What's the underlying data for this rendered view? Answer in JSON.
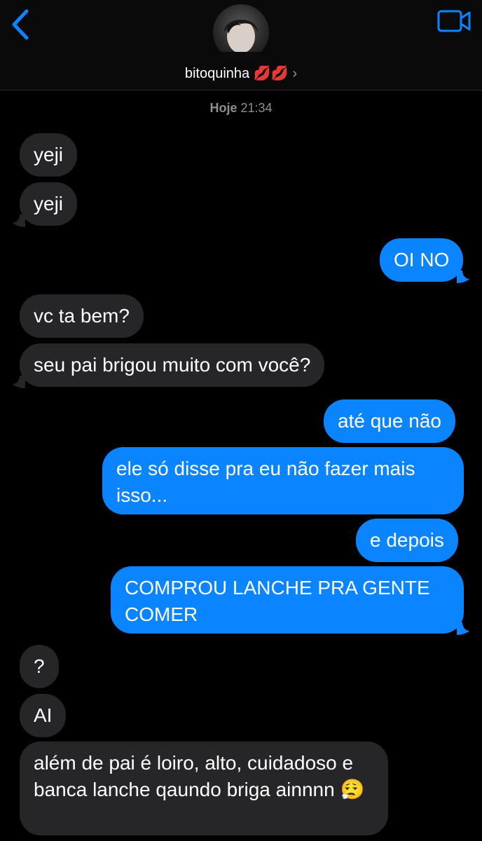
{
  "header": {
    "contact_name": "bitoquinha 💋💋",
    "chevron": "›",
    "icons": {
      "back": "chevron-left-icon",
      "video": "video-camera-icon"
    },
    "accent_color": "#0a84ff"
  },
  "timestamp": {
    "day": "Hoje",
    "time": "21:34"
  },
  "messages": [
    {
      "side": "in",
      "text": "yeji"
    },
    {
      "side": "in",
      "text": "yeji"
    },
    {
      "side": "out",
      "text": "OI NO"
    },
    {
      "side": "in",
      "text": "vc ta bem?"
    },
    {
      "side": "in",
      "text": "seu pai brigou muito com você?"
    },
    {
      "side": "out",
      "text": "até que não"
    },
    {
      "side": "out",
      "text": "ele só disse pra eu não fazer mais isso..."
    },
    {
      "side": "out",
      "text": "e depois"
    },
    {
      "side": "out",
      "text": "COMPROU LANCHE PRA GENTE COMER"
    },
    {
      "side": "in",
      "text": "?"
    },
    {
      "side": "in",
      "text": "AI"
    },
    {
      "side": "in",
      "text": "além de pai é loiro, alto, cuidadoso e banca lanche qaundo briga ainnnn 😮‍💨"
    }
  ],
  "colors": {
    "incoming_bubble": "#262628",
    "outgoing_bubble": "#0a84ff",
    "background": "#000000"
  }
}
